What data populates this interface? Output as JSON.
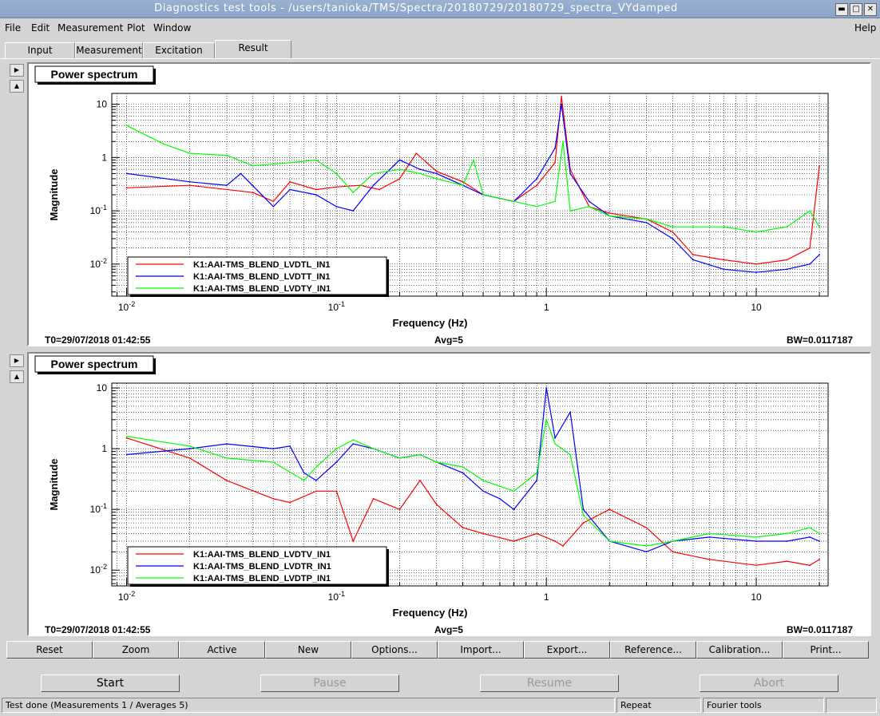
{
  "window": {
    "title": "Diagnostics test tools - /users/tanioka/TMS/Spectra/20180729/20180729_spectra_VYdamped",
    "controls": [
      "minimize",
      "maximize",
      "close"
    ]
  },
  "menu": {
    "file": "File",
    "edit": "Edit",
    "measurement": "Measurement",
    "plot": "Plot",
    "window": "Window",
    "help": "Help"
  },
  "tabs": [
    "Input",
    "Measurement",
    "Excitation",
    "Result"
  ],
  "active_tab": "Result",
  "plots": [
    {
      "panel_title": "Power spectrum",
      "ylabel": "Magnitude",
      "xlabel": "Frequency (Hz)",
      "t0": "T0=29/07/2018 01:42:55",
      "avg": "Avg=5",
      "bw": "BW=0.0117187",
      "legend": [
        "K1:AAI-TMS_BLEND_LVDTL_IN1",
        "K1:AAI-TMS_BLEND_LVDTT_IN1",
        "K1:AAI-TMS_BLEND_LVDTY_IN1"
      ],
      "y_ticks": [
        "10",
        "1",
        "10^-1",
        "10^-2"
      ],
      "x_ticks": [
        "10^-2",
        "10^-1",
        "1",
        "10"
      ]
    },
    {
      "panel_title": "Power spectrum",
      "ylabel": "Magnitude",
      "xlabel": "Frequency (Hz)",
      "t0": "T0=29/07/2018 01:42:55",
      "avg": "Avg=5",
      "bw": "BW=0.0117187",
      "legend": [
        "K1:AAI-TMS_BLEND_LVDTV_IN1",
        "K1:AAI-TMS_BLEND_LVDTR_IN1",
        "K1:AAI-TMS_BLEND_LVDTP_IN1"
      ],
      "y_ticks": [
        "10",
        "1",
        "10^-1",
        "10^-2"
      ],
      "x_ticks": [
        "10^-2",
        "10^-1",
        "1",
        "10"
      ]
    }
  ],
  "chart_data": [
    {
      "type": "line",
      "title": "Power spectrum",
      "xlabel": "Frequency (Hz)",
      "ylabel": "Magnitude",
      "xscale": "log",
      "yscale": "log",
      "xlim": [
        0.0085,
        22
      ],
      "ylim": [
        0.0025,
        16
      ],
      "grid": true,
      "legend_position": "bottom-left",
      "series": [
        {
          "name": "K1:AAI-TMS_BLEND_LVDTL_IN1",
          "color": "#ff0000",
          "x": [
            0.01,
            0.02,
            0.04,
            0.05,
            0.06,
            0.08,
            0.1,
            0.13,
            0.16,
            0.2,
            0.24,
            0.3,
            0.4,
            0.5,
            0.7,
            0.9,
            1.1,
            1.18,
            1.3,
            1.6,
            2,
            3,
            4,
            5,
            7,
            10,
            14,
            18,
            20
          ],
          "y": [
            0.27,
            0.3,
            0.22,
            0.15,
            0.35,
            0.25,
            0.28,
            0.3,
            0.25,
            0.4,
            1.2,
            0.55,
            0.35,
            0.2,
            0.15,
            0.3,
            0.8,
            14,
            0.6,
            0.12,
            0.09,
            0.07,
            0.04,
            0.015,
            0.012,
            0.01,
            0.012,
            0.02,
            0.7
          ]
        },
        {
          "name": "K1:AAI-TMS_BLEND_LVDTT_IN1",
          "color": "#0000ff",
          "x": [
            0.01,
            0.02,
            0.03,
            0.035,
            0.05,
            0.06,
            0.08,
            0.1,
            0.12,
            0.15,
            0.2,
            0.25,
            0.3,
            0.4,
            0.5,
            0.7,
            0.9,
            1.1,
            1.18,
            1.3,
            1.6,
            2,
            3,
            4,
            5,
            7,
            10,
            14,
            18,
            20
          ],
          "y": [
            0.5,
            0.35,
            0.3,
            0.5,
            0.12,
            0.25,
            0.2,
            0.12,
            0.1,
            0.3,
            0.9,
            0.6,
            0.5,
            0.3,
            0.2,
            0.15,
            0.4,
            1.5,
            10,
            0.5,
            0.15,
            0.08,
            0.06,
            0.03,
            0.012,
            0.008,
            0.007,
            0.008,
            0.01,
            0.015
          ]
        },
        {
          "name": "K1:AAI-TMS_BLEND_LVDTY_IN1",
          "color": "#00ff00",
          "x": [
            0.01,
            0.015,
            0.02,
            0.03,
            0.04,
            0.06,
            0.08,
            0.1,
            0.12,
            0.15,
            0.2,
            0.25,
            0.3,
            0.4,
            0.45,
            0.5,
            0.7,
            0.9,
            1.1,
            1.2,
            1.3,
            1.6,
            2,
            3,
            4,
            5,
            7,
            10,
            14,
            18,
            20
          ],
          "y": [
            4,
            1.8,
            1.2,
            1.1,
            0.7,
            0.8,
            0.9,
            0.5,
            0.22,
            0.5,
            0.6,
            0.5,
            0.4,
            0.3,
            0.9,
            0.2,
            0.15,
            0.12,
            0.15,
            2,
            0.1,
            0.12,
            0.08,
            0.07,
            0.05,
            0.05,
            0.05,
            0.04,
            0.05,
            0.1,
            0.05
          ]
        }
      ]
    },
    {
      "type": "line",
      "title": "Power spectrum",
      "xlabel": "Frequency (Hz)",
      "ylabel": "Magnitude",
      "xscale": "log",
      "yscale": "log",
      "xlim": [
        0.0085,
        22
      ],
      "ylim": [
        0.0055,
        12
      ],
      "grid": true,
      "legend_position": "bottom-left",
      "series": [
        {
          "name": "K1:AAI-TMS_BLEND_LVDTV_IN1",
          "color": "#ff0000",
          "x": [
            0.01,
            0.02,
            0.03,
            0.05,
            0.06,
            0.08,
            0.1,
            0.12,
            0.15,
            0.2,
            0.25,
            0.3,
            0.4,
            0.5,
            0.7,
            0.9,
            1.1,
            1.2,
            1.5,
            2,
            3,
            4,
            6,
            10,
            14,
            18,
            20
          ],
          "y": [
            1.5,
            0.7,
            0.3,
            0.15,
            0.13,
            0.2,
            0.2,
            0.03,
            0.15,
            0.1,
            0.3,
            0.12,
            0.05,
            0.04,
            0.03,
            0.04,
            0.03,
            0.025,
            0.06,
            0.1,
            0.05,
            0.02,
            0.015,
            0.012,
            0.014,
            0.012,
            0.015
          ]
        },
        {
          "name": "K1:AAI-TMS_BLEND_LVDTR_IN1",
          "color": "#0000ff",
          "x": [
            0.01,
            0.02,
            0.03,
            0.05,
            0.06,
            0.07,
            0.08,
            0.1,
            0.12,
            0.15,
            0.2,
            0.25,
            0.3,
            0.4,
            0.5,
            0.6,
            0.7,
            0.9,
            1.0,
            1.1,
            1.3,
            1.5,
            2,
            3,
            4,
            6,
            10,
            14,
            18,
            20
          ],
          "y": [
            0.8,
            1.0,
            1.2,
            1.0,
            1.1,
            0.4,
            0.3,
            0.6,
            1.2,
            1.0,
            0.7,
            0.8,
            0.6,
            0.4,
            0.2,
            0.15,
            0.1,
            0.3,
            10,
            1.5,
            4,
            0.1,
            0.03,
            0.02,
            0.03,
            0.035,
            0.03,
            0.03,
            0.035,
            0.03
          ]
        },
        {
          "name": "K1:AAI-TMS_BLEND_LVDTP_IN1",
          "color": "#00ff00",
          "x": [
            0.01,
            0.02,
            0.03,
            0.05,
            0.07,
            0.08,
            0.1,
            0.12,
            0.15,
            0.2,
            0.25,
            0.3,
            0.4,
            0.5,
            0.7,
            0.9,
            1.0,
            1.1,
            1.3,
            1.5,
            2,
            3,
            4,
            6,
            10,
            14,
            18,
            20
          ],
          "y": [
            1.6,
            1.1,
            0.7,
            0.6,
            0.3,
            0.5,
            1.0,
            1.4,
            1.0,
            0.7,
            0.8,
            0.6,
            0.5,
            0.3,
            0.2,
            0.4,
            3,
            1.2,
            0.8,
            0.08,
            0.03,
            0.025,
            0.03,
            0.04,
            0.035,
            0.04,
            0.05,
            0.04
          ]
        }
      ]
    }
  ],
  "control_buttons": [
    "Reset",
    "Zoom",
    "Active",
    "New",
    "Options...",
    "Import...",
    "Export...",
    "Reference...",
    "Calibration...",
    "Print..."
  ],
  "run_buttons": {
    "start": "Start",
    "pause": "Pause",
    "resume": "Resume",
    "abort": "Abort"
  },
  "status_bar": {
    "message": "Test done (Measurements 1 / Averages 5)",
    "mode": "Repeat",
    "tool": "Fourier tools",
    "extra": ""
  }
}
